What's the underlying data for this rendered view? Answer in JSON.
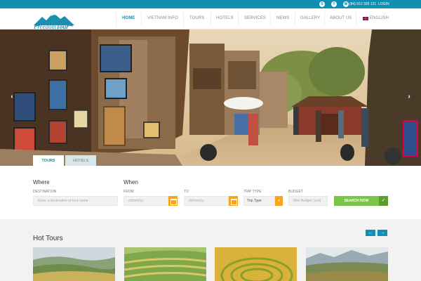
{
  "topbar": {
    "phone": "(84) 912 335 121",
    "login": "LOGIN",
    "skype_icon": "skype-icon",
    "yahoo_icon": "yahoo-icon",
    "phone_icon": "phone-icon"
  },
  "logo": {
    "name": "FreedomTour",
    "part1": "Freedom",
    "part2": "Tour"
  },
  "nav": {
    "items": [
      "HOME",
      "VIETNAM INFO",
      "TOURS",
      "HOTELS",
      "SERVICES",
      "NEWS",
      "GALLERY",
      "ABOUT US"
    ],
    "active": "HOME",
    "language": "ENGLISH"
  },
  "hero": {
    "prev": "‹",
    "next": "›"
  },
  "tabs": [
    "TOURS",
    "HOTELS"
  ],
  "search": {
    "where_title": "Where",
    "when_title": "When",
    "destination_label": "DESTINATION",
    "destination_placeholder": "Enter a destination or tour name",
    "from_label": "FROM",
    "from_placeholder": "dd/mm/yy",
    "to_label": "TO",
    "to_placeholder": "dd/mm/yy",
    "trip_type_label": "TRIP TYPE",
    "trip_type_value": "Trip Type",
    "budget_label": "BUDGET",
    "budget_placeholder": "Max Budget (usd)",
    "button": "SEARCH NOW"
  },
  "hot_tours": {
    "title": "Hot Tours",
    "prev": "←",
    "next": "→"
  },
  "colors": {
    "accent": "#0e8fb3",
    "orange": "#f5a623",
    "green": "#7cc349"
  }
}
